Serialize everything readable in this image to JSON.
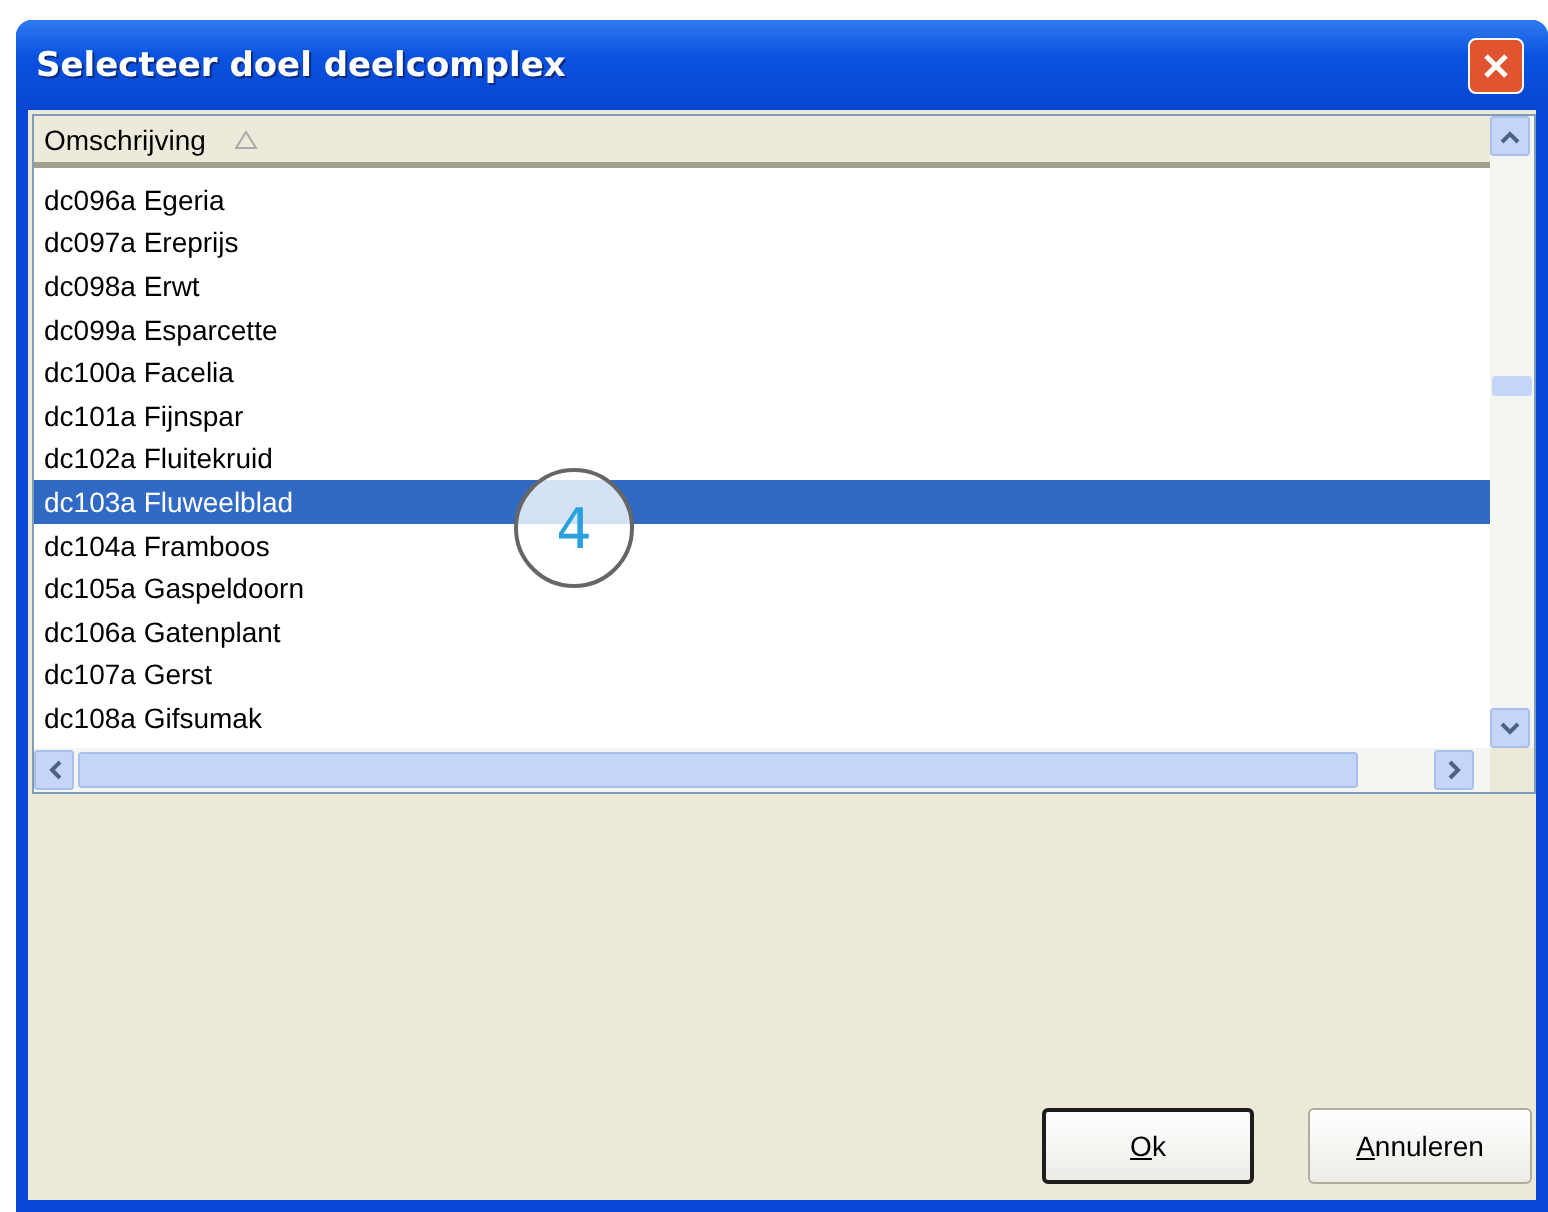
{
  "window": {
    "title": "Selecteer doel deelcomplex"
  },
  "list": {
    "columns": [
      {
        "label": "Omschrijving",
        "sorted": true
      }
    ],
    "rows": [
      {
        "label": "dc096a Egeria",
        "selected": false
      },
      {
        "label": "dc097a Ereprijs",
        "selected": false
      },
      {
        "label": "dc098a Erwt",
        "selected": false
      },
      {
        "label": "dc099a Esparcette",
        "selected": false
      },
      {
        "label": "dc100a Facelia",
        "selected": false
      },
      {
        "label": "dc101a Fijnspar",
        "selected": false
      },
      {
        "label": "dc102a Fluitekruid",
        "selected": false
      },
      {
        "label": "dc103a Fluweelblad",
        "selected": true
      },
      {
        "label": "dc104a Framboos",
        "selected": false
      },
      {
        "label": "dc105a Gaspeldoorn",
        "selected": false
      },
      {
        "label": "dc106a Gatenplant",
        "selected": false
      },
      {
        "label": "dc107a Gerst",
        "selected": false
      },
      {
        "label": "dc108a Gifsumak",
        "selected": false
      }
    ]
  },
  "callout": {
    "label": "4"
  },
  "buttons": [
    {
      "label": "**O**k",
      "default": true
    },
    {
      "label": "**A**nnuleren",
      "default": false
    }
  ]
}
